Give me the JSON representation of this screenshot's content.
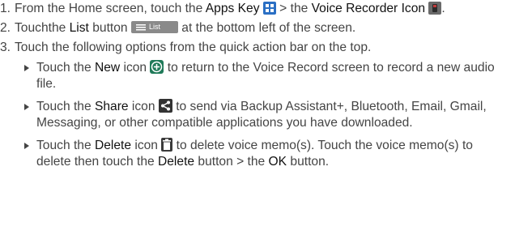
{
  "steps": [
    {
      "num": "1.",
      "t1": "From the Home screen, touch the ",
      "b1": "Apps Key",
      "t2": " > the ",
      "b2": "Voice Recorder Icon",
      "t3": "."
    },
    {
      "num": "2.",
      "t1": "Touchthe ",
      "b1": "List",
      "t2": " button ",
      "list_button_label": "List",
      "t3": " at the bottom left of the screen."
    },
    {
      "num": "3.",
      "t1": "Touch the following options from the quick action bar on the top."
    }
  ],
  "bullets": [
    {
      "t1": "Touch the ",
      "b1": "New",
      "t2": " icon ",
      "t3": " to return to the Voice Record screen to record a new audio file."
    },
    {
      "t1": "Touch the ",
      "b1": "Share",
      "t2": " icon ",
      "t3": " to send via Backup Assistant+, Bluetooth, Email, Gmail, Messaging, or other compatible applications you have downloaded."
    },
    {
      "t1": "Touch the ",
      "b1": "Delete",
      "t2": " icon ",
      "t3": " to delete voice memo(s). Touch the voice memo(s) to delete then touch the ",
      "b2": "Delete",
      "t4": " button > the ",
      "b3": "OK",
      "t5": " button."
    }
  ],
  "icons": {
    "apps_key": "apps-grid-icon",
    "voice_recorder": "voice-recorder-icon",
    "new": "plus-circle-icon",
    "share": "share-icon",
    "delete": "trash-icon"
  },
  "colors": {
    "text": "#444444",
    "apps_icon": "#2a6fc4",
    "new_icon": "#1f7a59"
  }
}
